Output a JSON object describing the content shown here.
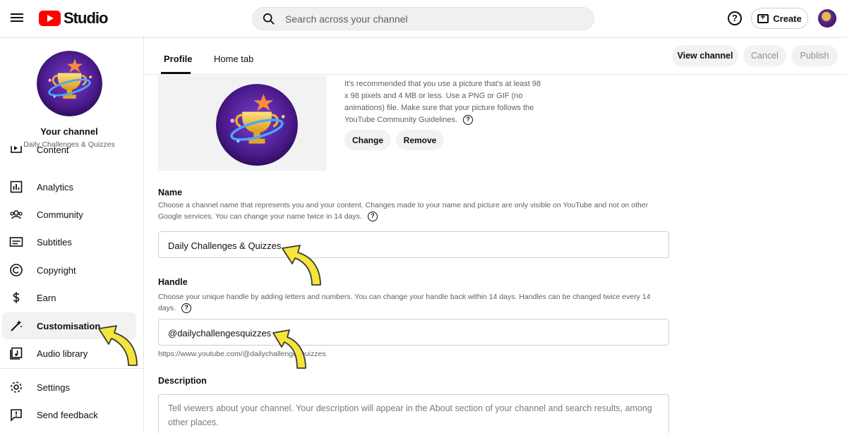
{
  "header": {
    "logo_text": "Studio",
    "search_placeholder": "Search across your channel",
    "help_glyph": "?",
    "create_label": "Create"
  },
  "sidebar": {
    "channel_title": "Your channel",
    "channel_name": "Daily Challenges & Quizzes",
    "items": [
      {
        "label": "Content",
        "icon": "content-icon"
      },
      {
        "label": "Analytics",
        "icon": "analytics-icon"
      },
      {
        "label": "Community",
        "icon": "community-icon"
      },
      {
        "label": "Subtitles",
        "icon": "subtitles-icon"
      },
      {
        "label": "Copyright",
        "icon": "copyright-icon"
      },
      {
        "label": "Earn",
        "icon": "earn-icon"
      },
      {
        "label": "Customisation",
        "icon": "customisation-icon",
        "active": true
      },
      {
        "label": "Audio library",
        "icon": "audio-library-icon"
      },
      {
        "label": "Settings",
        "icon": "settings-icon"
      },
      {
        "label": "Send feedback",
        "icon": "feedback-icon"
      }
    ]
  },
  "tabs": [
    {
      "label": "Profile",
      "active": true
    },
    {
      "label": "Home tab",
      "active": false
    }
  ],
  "actions": {
    "view_channel": "View channel",
    "cancel": "Cancel",
    "publish": "Publish"
  },
  "picture": {
    "description": "It's recommended that you use a picture that's at least 98 x 98 pixels and 4 MB or less. Use a PNG or GIF (no animations) file. Make sure that your picture follows the YouTube Community Guidelines.",
    "change_label": "Change",
    "remove_label": "Remove"
  },
  "name_section": {
    "title": "Name",
    "description": "Choose a channel name that represents you and your content. Changes made to your name and picture are only visible on YouTube and not on other Google services. You can change your name twice in 14 days.",
    "value": "Daily Challenges & Quizzes"
  },
  "handle_section": {
    "title": "Handle",
    "description": "Choose your unique handle by adding letters and numbers. You can change your handle back within 14 days. Handles can be changed twice every 14 days.",
    "value": "@dailychallengesquizzes",
    "url": "https://www.youtube.com/@dailychallengesquizzes"
  },
  "description_section": {
    "title": "Description",
    "placeholder": "Tell viewers about your channel. Your description will appear in the About section of your channel and search results, among other places."
  },
  "colors": {
    "brand_red": "#ff0000",
    "annotation_arrow": "#f5e43a",
    "arrow_outline": "#3a3a3a"
  }
}
